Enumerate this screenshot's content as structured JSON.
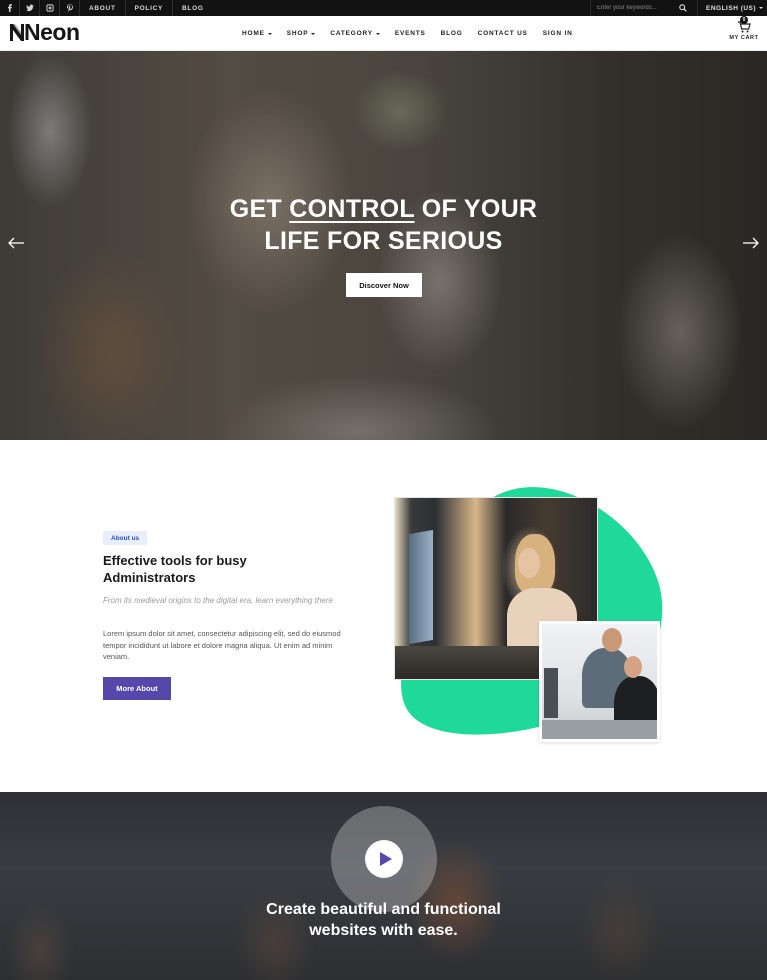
{
  "topbar": {
    "social": [
      {
        "icon": "facebook-icon"
      },
      {
        "icon": "twitter-icon"
      },
      {
        "icon": "instagram-icon"
      },
      {
        "icon": "pinterest-icon"
      }
    ],
    "links": [
      "ABOUT",
      "POLICY",
      "BLOG"
    ],
    "search_placeholder": "Enter your keywords...",
    "language": "ENGLISH (US)"
  },
  "header": {
    "logo": "Neon",
    "nav": [
      {
        "label": "HOME",
        "dropdown": true
      },
      {
        "label": "SHOP",
        "dropdown": true
      },
      {
        "label": "CATEGORY",
        "dropdown": true
      },
      {
        "label": "EVENTS",
        "dropdown": false
      },
      {
        "label": "BLOG",
        "dropdown": false
      },
      {
        "label": "CONTACT US",
        "dropdown": false
      },
      {
        "label": "SIGN IN",
        "dropdown": false
      }
    ],
    "cart_count": "0",
    "cart_label": "MY CART"
  },
  "hero": {
    "title_pre": "GET ",
    "title_underlined": "CONTROL",
    "title_post": " OF YOUR",
    "title_line2": "LIFE FOR SERIOUS",
    "button": "Discover Now"
  },
  "about": {
    "badge": "About us",
    "title": "Effective tools for busy Administrators",
    "lead": "From its medieval origins to the digital era, learn everything there",
    "body": "Lorem ipsum dolor sit amet, consectetur adipiscing elit, sed do eiusmod tempor incididunt ut labore et dolore magna aliqua. Ut enim ad minim veniam.",
    "button": "More About"
  },
  "video": {
    "title_line1": "Create beautiful and functional",
    "title_line2": "websites with ease."
  },
  "colors": {
    "topbar": "#121212",
    "accent_purple": "#5548aa",
    "accent_green": "#1ed99a",
    "badge_bg": "#e8eefb",
    "badge_text": "#2a4fbf"
  }
}
